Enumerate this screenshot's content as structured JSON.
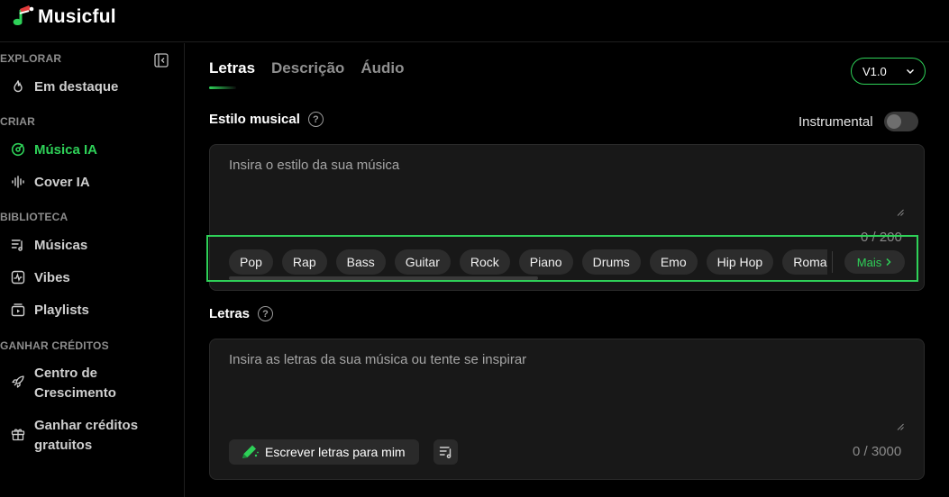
{
  "app": {
    "name": "Musicful"
  },
  "sidebar": {
    "sections": [
      {
        "title": "EXPLORAR"
      },
      {
        "title": "CRIAR"
      },
      {
        "title": "BIBLIOTECA"
      },
      {
        "title": "GANHAR CRÉDITOS"
      }
    ],
    "items": [
      {
        "label": "Em destaque",
        "icon": "flame-icon"
      },
      {
        "label": "Música IA",
        "icon": "music-disc-icon",
        "active": true
      },
      {
        "label": "Cover IA",
        "icon": "waveform-icon"
      },
      {
        "label": "Músicas",
        "icon": "music-list-icon"
      },
      {
        "label": "Vibes",
        "icon": "pulse-icon"
      },
      {
        "label": "Playlists",
        "icon": "playlist-icon"
      },
      {
        "label": "Centro de Crescimento",
        "icon": "rocket-icon"
      },
      {
        "label": "Ganhar créditos gratuitos",
        "icon": "gift-icon"
      }
    ]
  },
  "tabs": [
    {
      "label": "Letras",
      "active": true
    },
    {
      "label": "Descrição"
    },
    {
      "label": "Áudio"
    }
  ],
  "version": {
    "value": "V1.0"
  },
  "style_section": {
    "label": "Estilo musical",
    "instrumental_label": "Instrumental",
    "instrumental_on": false,
    "placeholder": "Insira o estilo da sua música",
    "counter": "0 / 200",
    "tags": [
      "Pop",
      "Rap",
      "Bass",
      "Guitar",
      "Rock",
      "Piano",
      "Drums",
      "Emo",
      "Hip Hop",
      "Romantic"
    ],
    "more_label": "Mais"
  },
  "lyrics_section": {
    "label": "Letras",
    "placeholder": "Insira as letras da sua música ou tente se inspirar",
    "write_button": "Escrever letras para mim",
    "counter": "0 / 3000"
  },
  "colors": {
    "accent": "#2ed158",
    "background": "#000000",
    "panel": "#181818"
  }
}
